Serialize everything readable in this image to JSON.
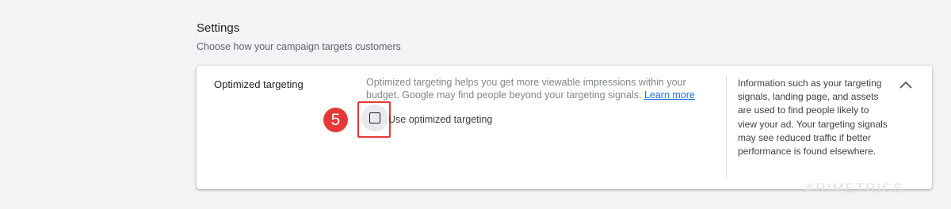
{
  "section": {
    "title": "Settings",
    "subtitle": "Choose how your campaign targets customers"
  },
  "card": {
    "label": "Optimized targeting",
    "description": "Optimized targeting helps you get more viewable impressions within your budget. Google may find people beyond your targeting signals.",
    "learn_more": "Learn more",
    "checkbox": {
      "label": "Use optimized targeting",
      "checked": false
    },
    "step_badge": "5",
    "help_text": "Information such as your targeting signals, landing page, and assets are used to find people likely to view your ad. Your targeting signals may see reduced traffic if better performance is found elsewhere.",
    "collapse_icon": "chevron-up-icon"
  },
  "watermark": "ARIMETRICS",
  "colors": {
    "link": "#1a73e8",
    "highlight": "#e53935",
    "background": "#f1f3f4"
  }
}
